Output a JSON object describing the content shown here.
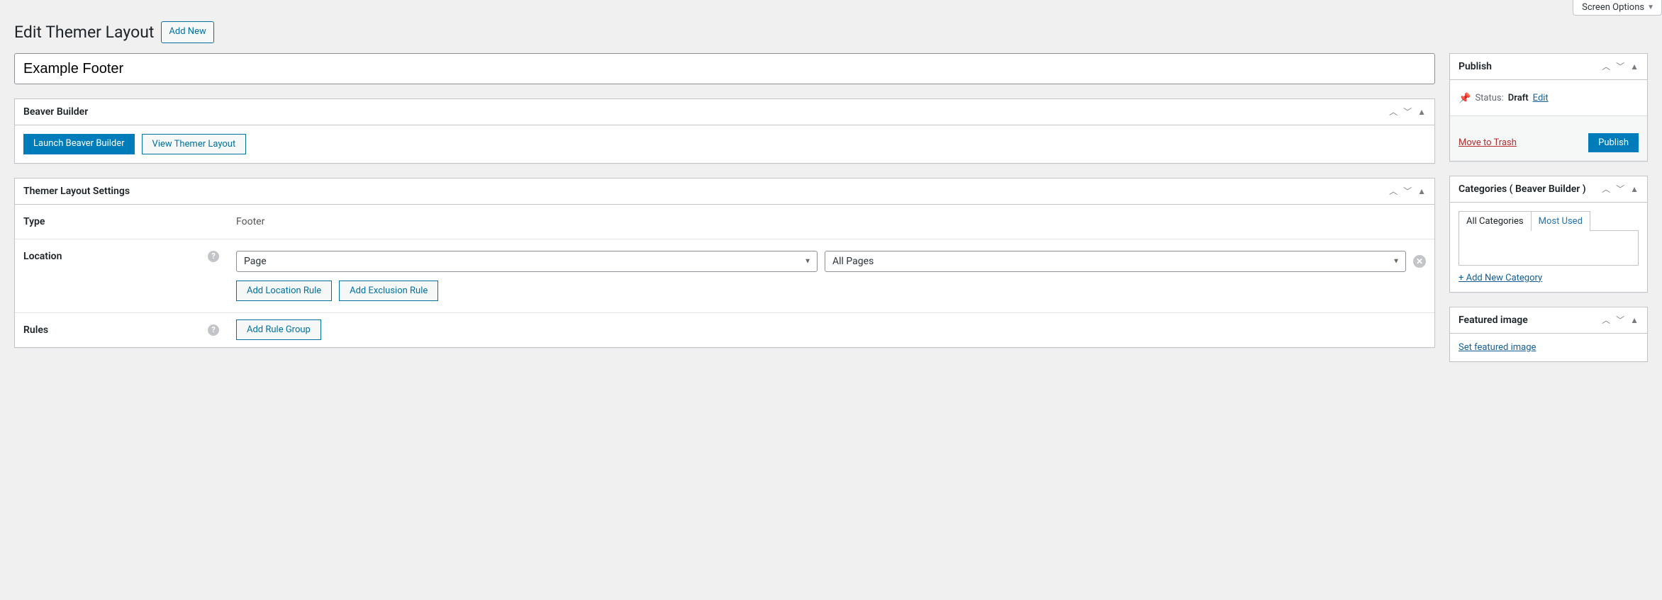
{
  "screen_options_label": "Screen Options",
  "page_title": "Edit Themer Layout",
  "add_new_label": "Add New",
  "title_value": "Example Footer",
  "boxes": {
    "beaver_builder": {
      "title": "Beaver Builder",
      "launch_label": "Launch Beaver Builder",
      "view_label": "View Themer Layout"
    },
    "settings": {
      "title": "Themer Layout Settings",
      "type_label": "Type",
      "type_value": "Footer",
      "location_label": "Location",
      "location_select1": "Page",
      "location_select2": "All Pages",
      "add_location_rule": "Add Location Rule",
      "add_exclusion_rule": "Add Exclusion Rule",
      "rules_label": "Rules",
      "add_rule_group": "Add Rule Group"
    }
  },
  "sidebar": {
    "publish": {
      "title": "Publish",
      "status_label": "Status:",
      "status_value": "Draft",
      "edit_label": "Edit",
      "trash_label": "Move to Trash",
      "publish_button": "Publish"
    },
    "categories": {
      "title": "Categories ( Beaver Builder )",
      "tab_all": "All Categories",
      "tab_most": "Most Used",
      "add_new": "+ Add New Category"
    },
    "featured": {
      "title": "Featured image",
      "set_link": "Set featured image"
    }
  }
}
